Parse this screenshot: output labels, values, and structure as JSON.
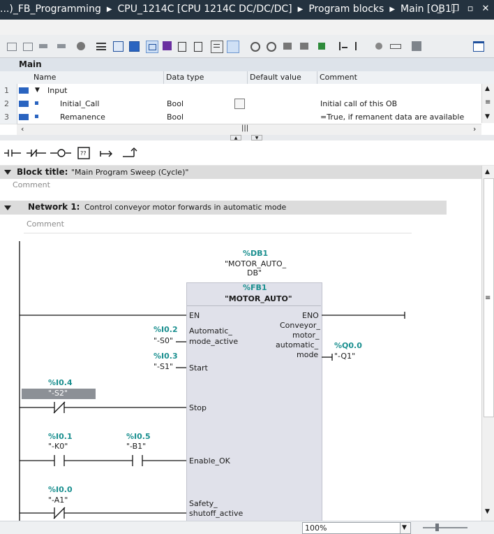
{
  "titlebar": {
    "crumbs": [
      "...)_FB_Programming",
      "CPU_1214C [CPU 1214C DC/DC/DC]",
      "Program blocks",
      "Main [OB1]"
    ]
  },
  "interface": {
    "title": "Main",
    "columns": [
      "Name",
      "Data type",
      "Default value",
      "Comment"
    ],
    "rows": [
      {
        "num": "1",
        "name": "Input",
        "type": "",
        "default": "",
        "comment": ""
      },
      {
        "num": "2",
        "name": "Initial_Call",
        "type": "Bool",
        "default": "",
        "comment": "Initial call of this OB"
      },
      {
        "num": "3",
        "name": "Remanence",
        "type": "Bool",
        "default": "",
        "comment": "=True, if remanent data are available"
      }
    ]
  },
  "block": {
    "title_label": "Block title:",
    "title_value": "\"Main Program Sweep (Cycle)\"",
    "comment": "Comment"
  },
  "network": {
    "label": "Network 1:",
    "title": "Control conveyor motor forwards in automatic mode",
    "comment": "Comment"
  },
  "fb": {
    "db_addr": "%DB1",
    "db_name_1": "\"MOTOR_AUTO_",
    "db_name_2": "DB\"",
    "fb_addr": "%FB1",
    "fb_name": "\"MOTOR_AUTO\"",
    "en": "EN",
    "eno": "ENO",
    "pin_auto_1": "Automatic_",
    "pin_auto_2": "mode_active",
    "pin_start": "Start",
    "pin_stop": "Stop",
    "pin_enable": "Enable_OK",
    "pin_safety_1": "Safety_",
    "pin_safety_2": "shutoff_active",
    "out_1": "Conveyor_",
    "out_2": "motor_",
    "out_3": "automatic_",
    "out_4": "mode"
  },
  "operands": {
    "i02_addr": "%I0.2",
    "i02_name": "\"-S0\"",
    "i03_addr": "%I0.3",
    "i03_name": "\"-S1\"",
    "i04_addr": "%I0.4",
    "i04_name": "\"-S2\"",
    "i01_addr": "%I0.1",
    "i01_name": "\"-K0\"",
    "i05_addr": "%I0.5",
    "i05_name": "\"-B1\"",
    "i00_addr": "%I0.0",
    "i00_name": "\"-A1\"",
    "q00_addr": "%Q0.0",
    "q00_name": "\"-Q1\""
  },
  "status": {
    "zoom": "100%"
  },
  "colors": {
    "titlebar": "#24323f",
    "address": "#1a8f8f",
    "header": "#dcdcdc"
  }
}
